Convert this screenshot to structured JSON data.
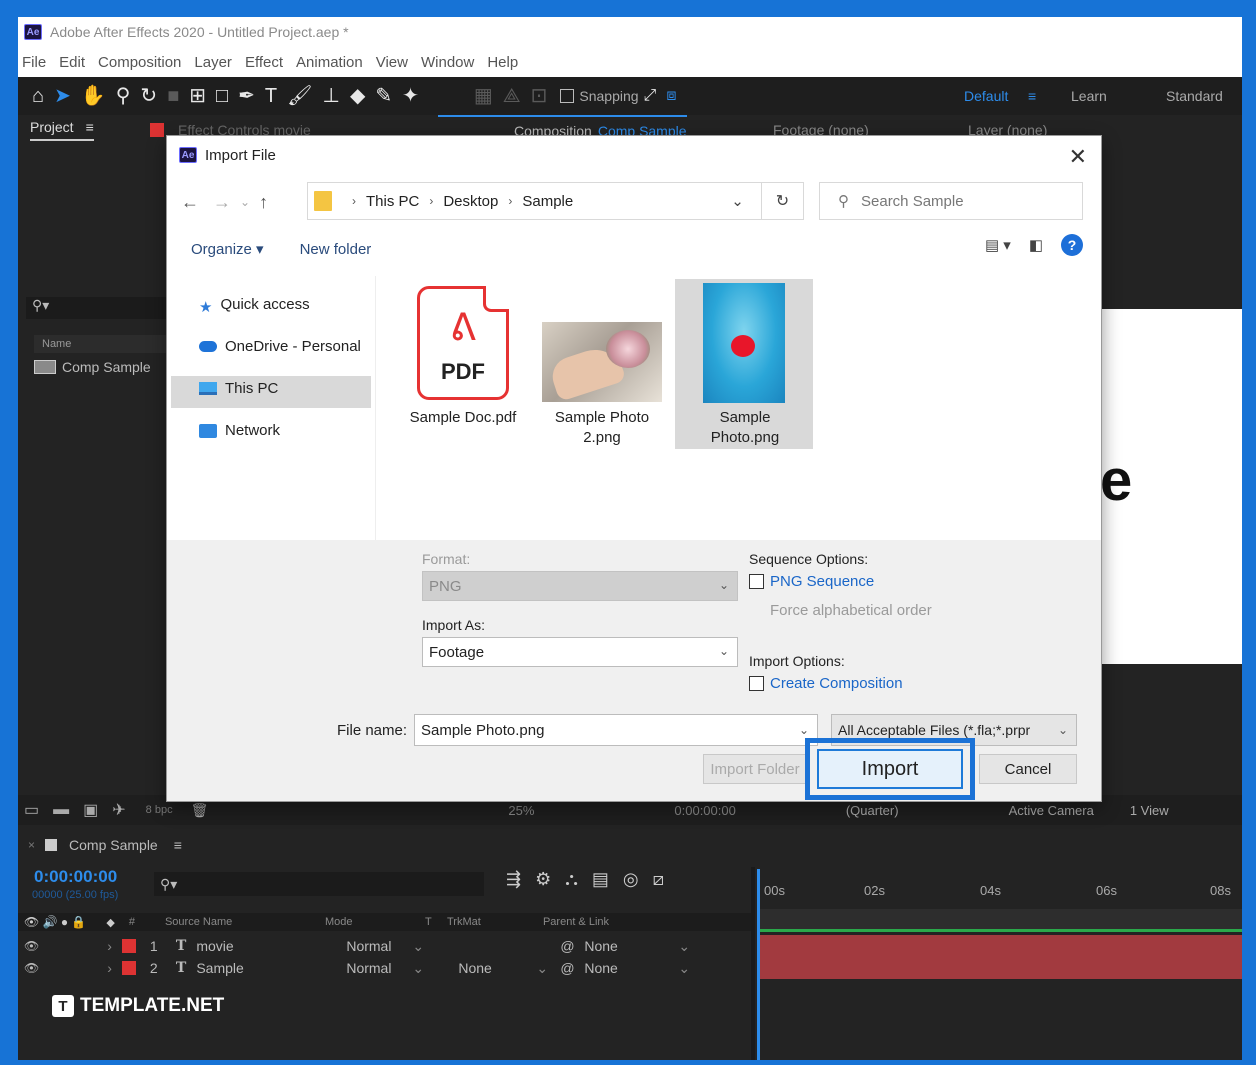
{
  "app": {
    "title": "Adobe After Effects 2020 - Untitled Project.aep *",
    "logo_text": "Ae"
  },
  "menu": [
    "File",
    "Edit",
    "Composition",
    "Layer",
    "Effect",
    "Animation",
    "View",
    "Window",
    "Help"
  ],
  "toolbar": {
    "snapping_label": "Snapping",
    "workspaces": [
      "Default",
      "Learn",
      "Standard"
    ]
  },
  "panels": {
    "project_tab": "Project",
    "effect_controls_tab": "Effect Controls movie",
    "composition_tab": "Composition",
    "composition_name": "Comp Sample",
    "footage_tab": "Footage (none)",
    "layer_tab": "Layer (none)",
    "name_header": "Name",
    "project_item": "Comp Sample",
    "bpc": "8 bpc"
  },
  "viewer_bar": {
    "zoom": "25%",
    "time": "0:00:00:00",
    "resolution": "(Quarter)",
    "camera": "Active Camera",
    "views": "1 View"
  },
  "timeline": {
    "tab": "Comp Sample",
    "timecode": "0:00:00:00",
    "fps": "00000 (25.00 fps)",
    "columns": [
      "Source Name",
      "Mode",
      "T",
      "TrkMat",
      "Parent & Link"
    ],
    "ruler": [
      "00s",
      "02s",
      "04s",
      "06s",
      "08s"
    ],
    "layers": [
      {
        "num": "1",
        "name": "movie",
        "mode": "Normal",
        "trkmat": "",
        "parent": "None"
      },
      {
        "num": "2",
        "name": "Sample",
        "mode": "Normal",
        "trkmat": "None",
        "parent": "None"
      }
    ]
  },
  "brand": "TEMPLATE.NET",
  "dialog": {
    "title": "Import File",
    "logo_text": "Ae",
    "path": [
      "This PC",
      "Desktop",
      "Sample"
    ],
    "search_placeholder": "Search Sample",
    "organize": "Organize",
    "new_folder": "New folder",
    "nav": [
      "Quick access",
      "OneDrive - Personal",
      "This PC",
      "Network"
    ],
    "files": [
      {
        "name": "Sample Doc.pdf",
        "icon": "pdf-icon"
      },
      {
        "name": "Sample Photo 2.png",
        "icon": "photo-thumbnail"
      },
      {
        "name": "Sample Photo.png",
        "icon": "photo-thumbnail"
      }
    ],
    "pdf_icon_text": "PDF",
    "format_label": "Format:",
    "format_value": "PNG",
    "import_as_label": "Import As:",
    "import_as_value": "Footage",
    "sequence_options_label": "Sequence Options:",
    "png_sequence": "PNG Sequence",
    "force_alpha": "Force alphabetical order",
    "import_options_label": "Import Options:",
    "create_composition": "Create Composition",
    "file_name_label": "File name:",
    "file_name_value": "Sample Photo.png",
    "file_type": "All Acceptable Files (*.fla;*.prpr",
    "import_folder": "Import Folder",
    "import": "Import",
    "cancel": "Cancel"
  },
  "colors": {
    "frame": "#1773d6",
    "accent": "#2d8ceb",
    "layer_red": "#d33333",
    "track": "#a23a3f"
  }
}
